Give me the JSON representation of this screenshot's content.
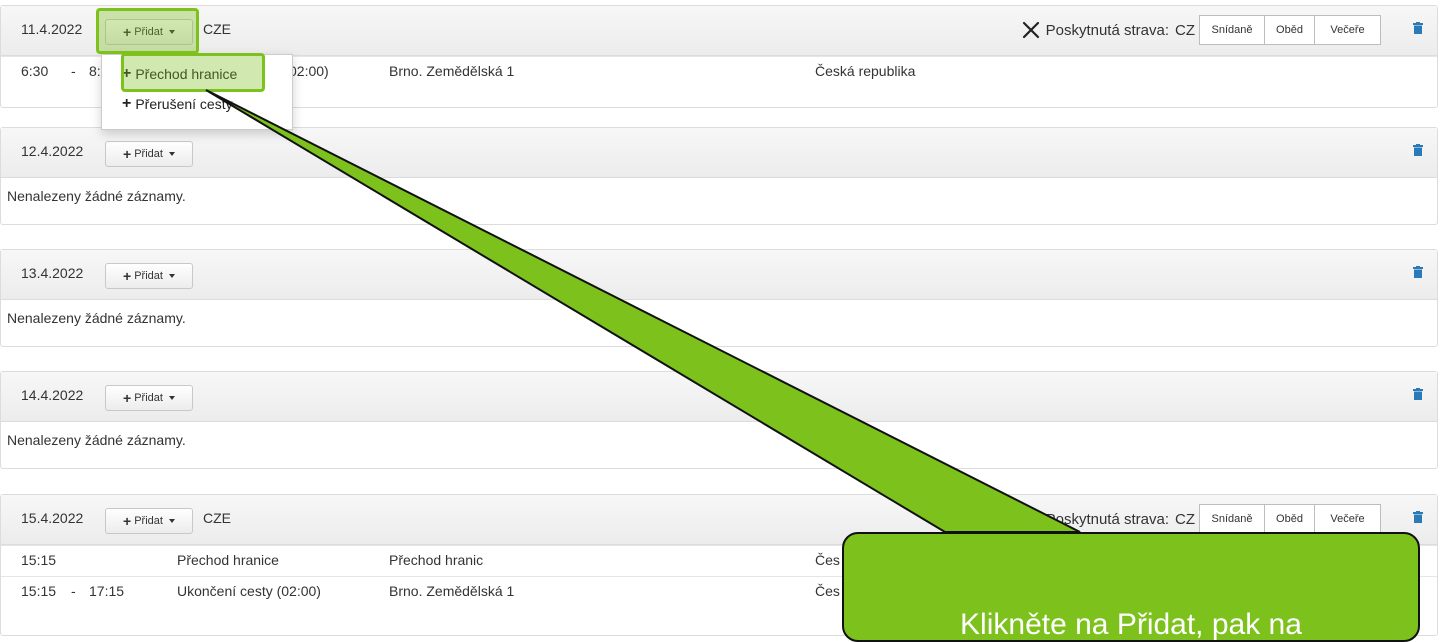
{
  "add_label": "Přidat",
  "meal": {
    "label": "Poskytnutá strava:",
    "country": "CZ",
    "breakfast": "Snídaně",
    "lunch": "Oběd",
    "dinner": "Večeře"
  },
  "days": [
    {
      "date": "11.4.2022",
      "country": "CZE",
      "rows": [
        {
          "time_from": "6:30",
          "dash": "-",
          "time_to": "8:",
          "type": "02:00)",
          "place": "Brno. Zemědělská 1",
          "country": "Česká republika"
        }
      ]
    },
    {
      "date": "12.4.2022",
      "empty": "Nenalezeny žádné záznamy."
    },
    {
      "date": "13.4.2022",
      "empty": "Nenalezeny žádné záznamy."
    },
    {
      "date": "14.4.2022",
      "empty": "Nenalezeny žádné záznamy."
    },
    {
      "date": "15.4.2022",
      "country": "CZE",
      "rows": [
        {
          "time_from": "15:15",
          "type": "Přechod hranice",
          "place": "Přechod hranic",
          "country": "Čes"
        },
        {
          "time_from": "15:15",
          "dash": "-",
          "time_to": "17:15",
          "type": "Ukončení cesty (02:00)",
          "place": "Brno. Zemědělská 1",
          "country": "Čes"
        }
      ]
    }
  ],
  "dropdown": {
    "item1": "Přechod hranice",
    "item2": "Přerušení cesty"
  },
  "callout": {
    "text": "Klikněte na Přidat, pak na",
    "color": "#7cc11c"
  },
  "icons": {
    "trash": "trash-icon",
    "meal": "fork-knife-icon",
    "plus": "plus-icon",
    "caret": "caret-down-icon"
  }
}
